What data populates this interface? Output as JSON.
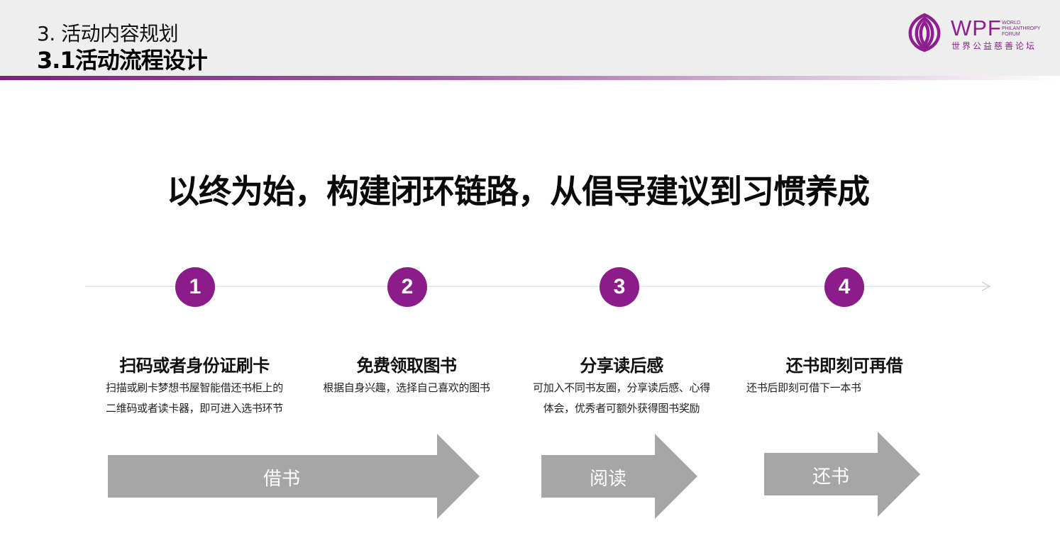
{
  "header": {
    "section_label": "3. 活动内容规划",
    "section_title": "3.1活动流程设计",
    "logo": {
      "brand": "WPF",
      "english_lines": [
        "WORLD",
        "PHILANTHROPY",
        "FORUM"
      ],
      "chinese": "世界公益慈善论坛"
    }
  },
  "headline": "以终为始，构建闭环链路，从倡导建议到习惯养成",
  "steps": [
    {
      "number": "1",
      "title": "扫码或者身份证刷卡",
      "desc_lines": [
        "扫描或刷卡梦想书屋智能借还书柜上的",
        "二维码或者读卡器，即可进入选书环节"
      ]
    },
    {
      "number": "2",
      "title": "免费领取图书",
      "desc_lines": [
        "根据自身兴趣，选择自己喜欢的图书"
      ]
    },
    {
      "number": "3",
      "title": "分享读后感",
      "desc_lines": [
        "可加入不同书友圈，分享读后感、心得",
        "体会，优秀者可额外获得图书奖励"
      ]
    },
    {
      "number": "4",
      "title": "还书即刻可再借",
      "desc_lines": [
        "还书后即刻可借下一本书"
      ]
    }
  ],
  "phases": [
    {
      "label": "借书"
    },
    {
      "label": "阅读"
    },
    {
      "label": "还书"
    }
  ],
  "colors": {
    "accent": "#8b1c8a",
    "arrow": "#a6a6a6",
    "header_bg": "#eeeeee",
    "timeline": "#d9d9d9"
  }
}
